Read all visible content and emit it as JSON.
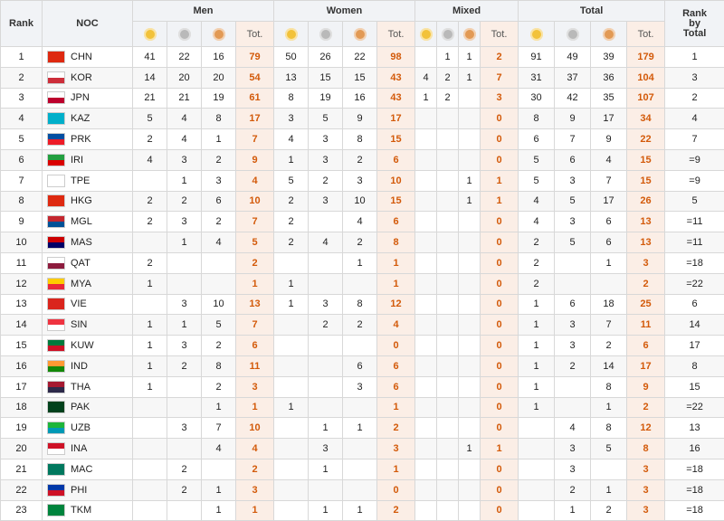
{
  "headers": {
    "rank": "Rank",
    "noc": "NOC",
    "groups": [
      "Men",
      "Women",
      "Mixed",
      "Total"
    ],
    "tot": "Tot.",
    "rank_by_total": [
      "Rank",
      "by",
      "Total"
    ]
  },
  "medals": [
    {
      "icon": "gold-medal-icon",
      "color": "#f2c23a"
    },
    {
      "icon": "silver-medal-icon",
      "color": "#b9b9b9"
    },
    {
      "icon": "bronze-medal-icon",
      "color": "#e29a55"
    }
  ],
  "rows": [
    {
      "rank": "1",
      "noc": "CHN",
      "flag": [
        "#de2910",
        "#de2910"
      ],
      "men": [
        "41",
        "22",
        "16",
        "79"
      ],
      "women": [
        "50",
        "26",
        "22",
        "98"
      ],
      "mixed": [
        "",
        "1",
        "1",
        "2"
      ],
      "total": [
        "91",
        "49",
        "39",
        "179"
      ],
      "rbt": "1"
    },
    {
      "rank": "2",
      "noc": "KOR",
      "flag": [
        "#ffffff",
        "#cd2e3a"
      ],
      "men": [
        "14",
        "20",
        "20",
        "54"
      ],
      "women": [
        "13",
        "15",
        "15",
        "43"
      ],
      "mixed": [
        "4",
        "2",
        "1",
        "7"
      ],
      "total": [
        "31",
        "37",
        "36",
        "104"
      ],
      "rbt": "3"
    },
    {
      "rank": "3",
      "noc": "JPN",
      "flag": [
        "#ffffff",
        "#bc002d"
      ],
      "men": [
        "21",
        "21",
        "19",
        "61"
      ],
      "women": [
        "8",
        "19",
        "16",
        "43"
      ],
      "mixed": [
        "1",
        "2",
        "",
        "3"
      ],
      "total": [
        "30",
        "42",
        "35",
        "107"
      ],
      "rbt": "2"
    },
    {
      "rank": "4",
      "noc": "KAZ",
      "flag": [
        "#00afca",
        "#00afca"
      ],
      "men": [
        "5",
        "4",
        "8",
        "17"
      ],
      "women": [
        "3",
        "5",
        "9",
        "17"
      ],
      "mixed": [
        "",
        "",
        "",
        "0"
      ],
      "total": [
        "8",
        "9",
        "17",
        "34"
      ],
      "rbt": "4"
    },
    {
      "rank": "5",
      "noc": "PRK",
      "flag": [
        "#024fa2",
        "#ed1c27"
      ],
      "men": [
        "2",
        "4",
        "1",
        "7"
      ],
      "women": [
        "4",
        "3",
        "8",
        "15"
      ],
      "mixed": [
        "",
        "",
        "",
        "0"
      ],
      "total": [
        "6",
        "7",
        "9",
        "22"
      ],
      "rbt": "7"
    },
    {
      "rank": "6",
      "noc": "IRI",
      "flag": [
        "#239f40",
        "#da0000"
      ],
      "men": [
        "4",
        "3",
        "2",
        "9"
      ],
      "women": [
        "1",
        "3",
        "2",
        "6"
      ],
      "mixed": [
        "",
        "",
        "",
        "0"
      ],
      "total": [
        "5",
        "6",
        "4",
        "15"
      ],
      "rbt": "=9"
    },
    {
      "rank": "7",
      "noc": "TPE",
      "flag": [
        "#ffffff",
        "#ffffff"
      ],
      "men": [
        "",
        "1",
        "3",
        "4"
      ],
      "women": [
        "5",
        "2",
        "3",
        "10"
      ],
      "mixed": [
        "",
        "",
        "1",
        "1"
      ],
      "total": [
        "5",
        "3",
        "7",
        "15"
      ],
      "rbt": "=9"
    },
    {
      "rank": "8",
      "noc": "HKG",
      "flag": [
        "#de2910",
        "#de2910"
      ],
      "men": [
        "2",
        "2",
        "6",
        "10"
      ],
      "women": [
        "2",
        "3",
        "10",
        "15"
      ],
      "mixed": [
        "",
        "",
        "1",
        "1"
      ],
      "total": [
        "4",
        "5",
        "17",
        "26"
      ],
      "rbt": "5"
    },
    {
      "rank": "9",
      "noc": "MGL",
      "flag": [
        "#c4272f",
        "#015197"
      ],
      "men": [
        "2",
        "3",
        "2",
        "7"
      ],
      "women": [
        "2",
        "",
        "4",
        "6"
      ],
      "mixed": [
        "",
        "",
        "",
        "0"
      ],
      "total": [
        "4",
        "3",
        "6",
        "13"
      ],
      "rbt": "=11"
    },
    {
      "rank": "10",
      "noc": "MAS",
      "flag": [
        "#cc0001",
        "#010066"
      ],
      "men": [
        "",
        "1",
        "4",
        "5"
      ],
      "women": [
        "2",
        "4",
        "2",
        "8"
      ],
      "mixed": [
        "",
        "",
        "",
        "0"
      ],
      "total": [
        "2",
        "5",
        "6",
        "13"
      ],
      "rbt": "=11"
    },
    {
      "rank": "11",
      "noc": "QAT",
      "flag": [
        "#ffffff",
        "#8d1b3d"
      ],
      "men": [
        "2",
        "",
        "",
        "2"
      ],
      "women": [
        "",
        "",
        "1",
        "1"
      ],
      "mixed": [
        "",
        "",
        "",
        "0"
      ],
      "total": [
        "2",
        "",
        "1",
        "3"
      ],
      "rbt": "=18"
    },
    {
      "rank": "12",
      "noc": "MYA",
      "flag": [
        "#fecb00",
        "#ea2839"
      ],
      "men": [
        "1",
        "",
        "",
        "1"
      ],
      "women": [
        "1",
        "",
        "",
        "1"
      ],
      "mixed": [
        "",
        "",
        "",
        "0"
      ],
      "total": [
        "2",
        "",
        "",
        "2"
      ],
      "rbt": "=22"
    },
    {
      "rank": "13",
      "noc": "VIE",
      "flag": [
        "#da251d",
        "#da251d"
      ],
      "men": [
        "",
        "3",
        "10",
        "13"
      ],
      "women": [
        "1",
        "3",
        "8",
        "12"
      ],
      "mixed": [
        "",
        "",
        "",
        "0"
      ],
      "total": [
        "1",
        "6",
        "18",
        "25"
      ],
      "rbt": "6"
    },
    {
      "rank": "14",
      "noc": "SIN",
      "flag": [
        "#ef3340",
        "#ffffff"
      ],
      "men": [
        "1",
        "1",
        "5",
        "7"
      ],
      "women": [
        "",
        "2",
        "2",
        "4"
      ],
      "mixed": [
        "",
        "",
        "",
        "0"
      ],
      "total": [
        "1",
        "3",
        "7",
        "11"
      ],
      "rbt": "14"
    },
    {
      "rank": "15",
      "noc": "KUW",
      "flag": [
        "#007a3d",
        "#ce1126"
      ],
      "men": [
        "1",
        "3",
        "2",
        "6"
      ],
      "women": [
        "",
        "",
        "",
        "0"
      ],
      "mixed": [
        "",
        "",
        "",
        "0"
      ],
      "total": [
        "1",
        "3",
        "2",
        "6"
      ],
      "rbt": "17"
    },
    {
      "rank": "16",
      "noc": "IND",
      "flag": [
        "#ff9933",
        "#138808"
      ],
      "men": [
        "1",
        "2",
        "8",
        "11"
      ],
      "women": [
        "",
        "",
        "6",
        "6"
      ],
      "mixed": [
        "",
        "",
        "",
        "0"
      ],
      "total": [
        "1",
        "2",
        "14",
        "17"
      ],
      "rbt": "8"
    },
    {
      "rank": "17",
      "noc": "THA",
      "flag": [
        "#a51931",
        "#2d2a4a"
      ],
      "men": [
        "1",
        "",
        "2",
        "3"
      ],
      "women": [
        "",
        "",
        "3",
        "6"
      ],
      "mixed": [
        "",
        "",
        "",
        "0"
      ],
      "total": [
        "1",
        "",
        "8",
        "9"
      ],
      "rbt": "15"
    },
    {
      "rank": "18",
      "noc": "PAK",
      "flag": [
        "#01411c",
        "#01411c"
      ],
      "men": [
        "",
        "",
        "1",
        "1"
      ],
      "women": [
        "1",
        "",
        "",
        "1"
      ],
      "mixed": [
        "",
        "",
        "",
        "0"
      ],
      "total": [
        "1",
        "",
        "1",
        "2"
      ],
      "rbt": "=22"
    },
    {
      "rank": "19",
      "noc": "UZB",
      "flag": [
        "#1eb53a",
        "#0099b5"
      ],
      "men": [
        "",
        "3",
        "7",
        "10"
      ],
      "women": [
        "",
        "1",
        "1",
        "2"
      ],
      "mixed": [
        "",
        "",
        "",
        "0"
      ],
      "total": [
        "",
        "4",
        "8",
        "12"
      ],
      "rbt": "13"
    },
    {
      "rank": "20",
      "noc": "INA",
      "flag": [
        "#ce1126",
        "#ffffff"
      ],
      "men": [
        "",
        "",
        "4",
        "4"
      ],
      "women": [
        "",
        "3",
        "",
        "3"
      ],
      "mixed": [
        "",
        "",
        "1",
        "1"
      ],
      "total": [
        "",
        "3",
        "5",
        "8"
      ],
      "rbt": "16"
    },
    {
      "rank": "21",
      "noc": "MAC",
      "flag": [
        "#00785e",
        "#00785e"
      ],
      "men": [
        "",
        "2",
        "",
        "2"
      ],
      "women": [
        "",
        "1",
        "",
        "1"
      ],
      "mixed": [
        "",
        "",
        "",
        "0"
      ],
      "total": [
        "",
        "3",
        "",
        "3"
      ],
      "rbt": "=18"
    },
    {
      "rank": "22",
      "noc": "PHI",
      "flag": [
        "#0038a8",
        "#ce1126"
      ],
      "men": [
        "",
        "2",
        "1",
        "3"
      ],
      "women": [
        "",
        "",
        "",
        "0"
      ],
      "mixed": [
        "",
        "",
        "",
        "0"
      ],
      "total": [
        "",
        "2",
        "1",
        "3"
      ],
      "rbt": "=18"
    },
    {
      "rank": "23",
      "noc": "TKM",
      "flag": [
        "#00843d",
        "#00843d"
      ],
      "men": [
        "",
        "",
        "1",
        "1"
      ],
      "women": [
        "",
        "1",
        "1",
        "2"
      ],
      "mixed": [
        "",
        "",
        "",
        "0"
      ],
      "total": [
        "",
        "1",
        "2",
        "3"
      ],
      "rbt": "=18"
    }
  ]
}
